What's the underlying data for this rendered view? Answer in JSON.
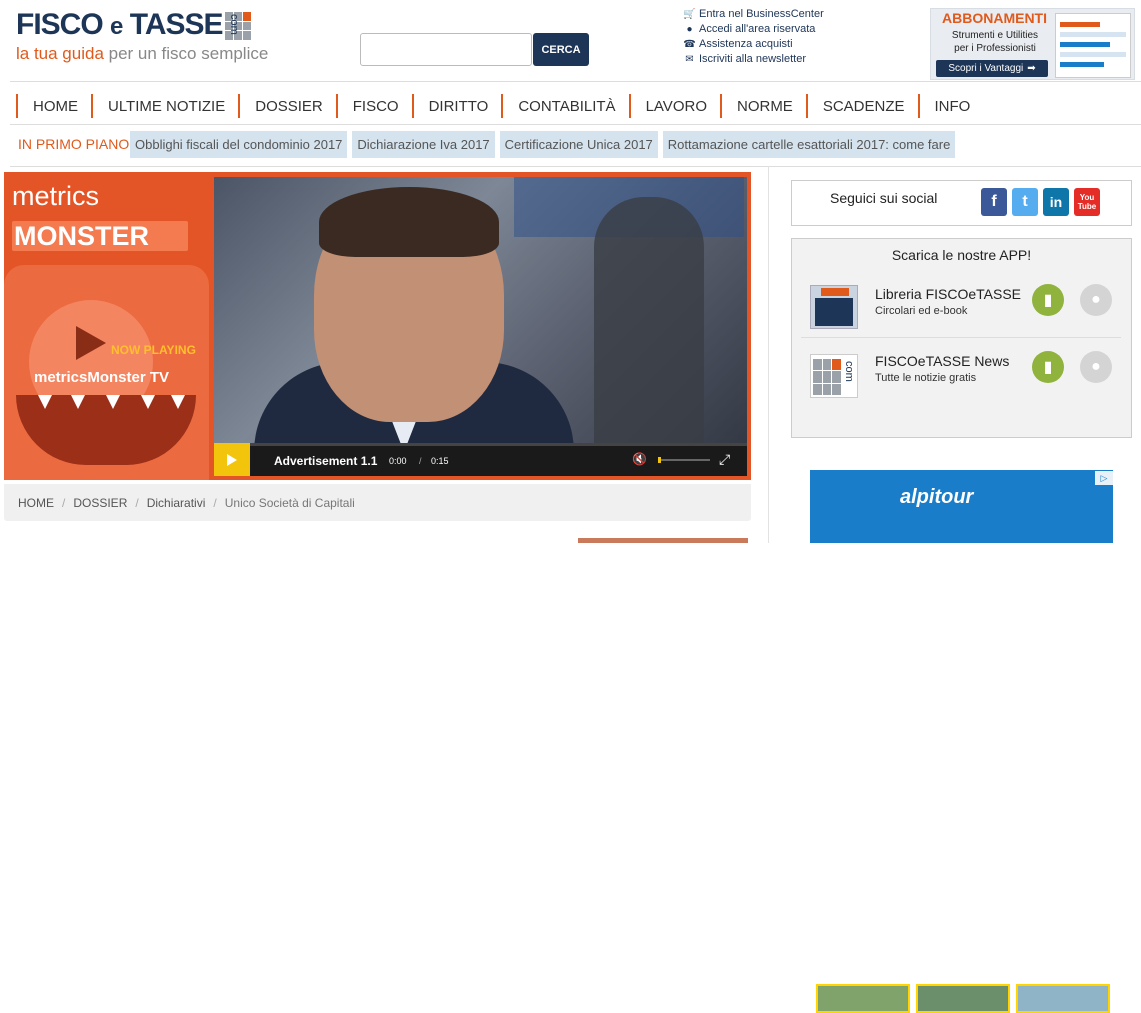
{
  "header": {
    "logo": {
      "brand": "FISCO",
      "e": "e",
      "brand2": "TASSE",
      "com": "com"
    },
    "tagline": {
      "highlight": "la tua guida",
      "rest": " per un fisco semplice"
    },
    "search": {
      "placeholder": "",
      "button": "CERCA"
    },
    "links": [
      {
        "icon": "cart-icon",
        "label": "Entra nel BusinessCenter"
      },
      {
        "icon": "lock-icon",
        "label": "Accedi all'area riservata"
      },
      {
        "icon": "support-icon",
        "label": "Assistenza acquisti"
      },
      {
        "icon": "mail-icon",
        "label": "Iscriviti alla newsletter"
      }
    ],
    "promo": {
      "title": "ABBONAMENTI",
      "line1": "Strumenti e Utilities",
      "line2": "per i Professionisti",
      "cta": "Scopri i Vantaggi"
    }
  },
  "nav": [
    "HOME",
    "ULTIME NOTIZIE",
    "DOSSIER",
    "FISCO",
    "DIRITTO",
    "CONTABILITÀ",
    "LAVORO",
    "NORME",
    "SCADENZE",
    "INFO"
  ],
  "primo_piano": {
    "label": "IN PRIMO PIANO:",
    "tags": [
      "Obblighi fiscali del condominio 2017",
      "Dichiarazione Iva 2017",
      "Certificazione Unica 2017",
      "Rottamazione cartelle esattoriali 2017: come fare"
    ]
  },
  "video": {
    "brand_top": "metrics",
    "brand_bottom": "MONSTER",
    "now_playing": "NOW PLAYING",
    "channel": "metricsMonster TV",
    "ad_label": "Advertisement 1.1",
    "time": "0:00",
    "sep": "/",
    "duration": "0:15",
    "volume_level": 0.05
  },
  "breadcrumb": [
    "HOME",
    "DOSSIER",
    "Dichiarativi",
    "Unico Società di Capitali"
  ],
  "sidebar": {
    "social_label": "Seguici sui social",
    "social": [
      {
        "icon": "facebook-icon",
        "glyph": "f",
        "color": "#3b5998"
      },
      {
        "icon": "twitter-icon",
        "glyph": "t",
        "color": "#55acee"
      },
      {
        "icon": "linkedin-icon",
        "glyph": "in",
        "color": "#0e76a8"
      },
      {
        "icon": "youtube-icon",
        "glyph": "You Tube",
        "color": "#e52d27"
      }
    ],
    "apps_title": "Scarica le nostre APP!",
    "apps": [
      {
        "name": "Libreria FISCOeTASSE",
        "desc": "Circolari ed e-book",
        "icon_label": "FISCO e TASSE"
      },
      {
        "name": "FISCOeTASSE News",
        "desc": "Tutte le notizie gratis",
        "icon_label": "com"
      }
    ],
    "ad": {
      "logo": "alpitour",
      "corner": "▷"
    }
  }
}
